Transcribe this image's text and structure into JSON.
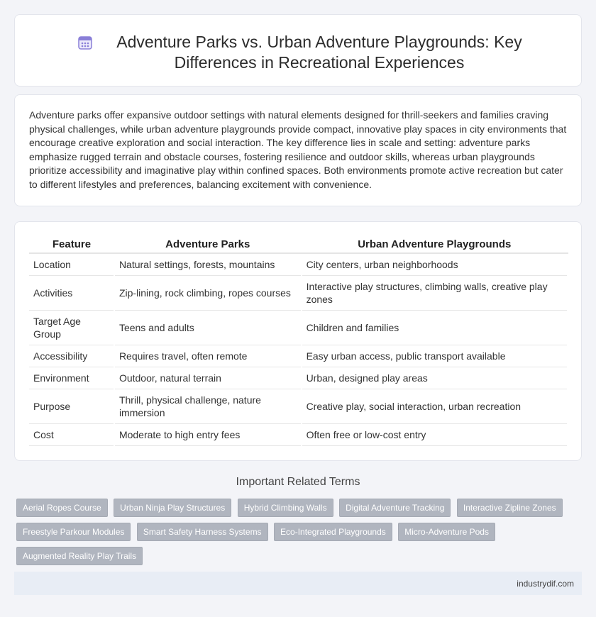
{
  "header": {
    "title": "Adventure Parks vs. Urban Adventure Playgrounds: Key Differences in Recreational Experiences",
    "icon": "calendar-icon"
  },
  "intro": {
    "text": "Adventure parks offer expansive outdoor settings with natural elements designed for thrill-seekers and families craving physical challenges, while urban adventure playgrounds provide compact, innovative play spaces in city environments that encourage creative exploration and social interaction. The key difference lies in scale and setting: adventure parks emphasize rugged terrain and obstacle courses, fostering resilience and outdoor skills, whereas urban playgrounds prioritize accessibility and imaginative play within confined spaces. Both environments promote active recreation but cater to different lifestyles and preferences, balancing excitement with convenience."
  },
  "table": {
    "headers": [
      "Feature",
      "Adventure Parks",
      "Urban Adventure Playgrounds"
    ],
    "rows": [
      [
        "Location",
        "Natural settings, forests, mountains",
        "City centers, urban neighborhoods"
      ],
      [
        "Activities",
        "Zip-lining, rock climbing, ropes courses",
        "Interactive play structures, climbing walls, creative play zones"
      ],
      [
        "Target Age Group",
        "Teens and adults",
        "Children and families"
      ],
      [
        "Accessibility",
        "Requires travel, often remote",
        "Easy urban access, public transport available"
      ],
      [
        "Environment",
        "Outdoor, natural terrain",
        "Urban, designed play areas"
      ],
      [
        "Purpose",
        "Thrill, physical challenge, nature immersion",
        "Creative play, social interaction, urban recreation"
      ],
      [
        "Cost",
        "Moderate to high entry fees",
        "Often free or low-cost entry"
      ]
    ]
  },
  "related": {
    "title": "Important Related Terms",
    "tags": [
      "Aerial Ropes Course",
      "Urban Ninja Play Structures",
      "Hybrid Climbing Walls",
      "Digital Adventure Tracking",
      "Interactive Zipline Zones",
      "Freestyle Parkour Modules",
      "Smart Safety Harness Systems",
      "Eco-Integrated Playgrounds",
      "Micro-Adventure Pods",
      "Augmented Reality Play Trails"
    ]
  },
  "footer": {
    "site": "industrydif.com"
  },
  "colors": {
    "background": "#f3f4f8",
    "tag": "#b0b5bf",
    "footer": "#e8edf5",
    "icon_accent": "#8a7fd8"
  }
}
